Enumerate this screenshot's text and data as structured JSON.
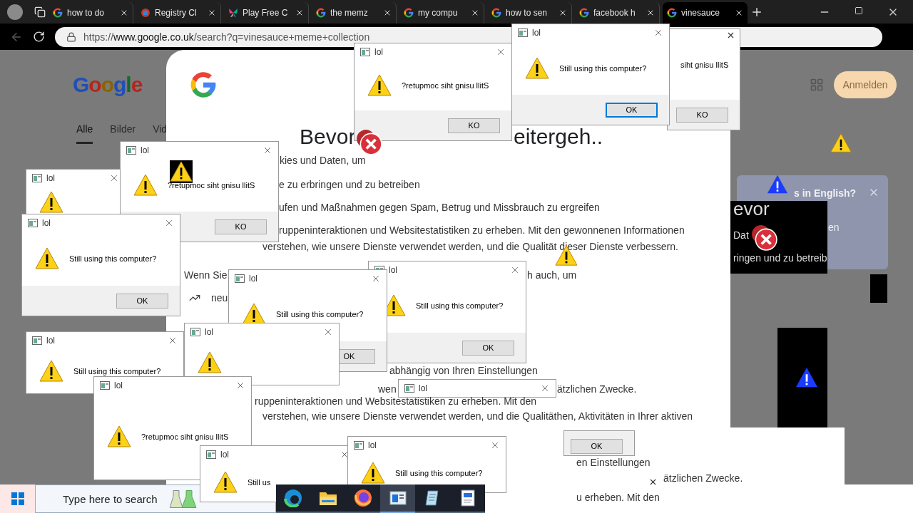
{
  "tabs": [
    {
      "title": "how to do",
      "kind": "google",
      "selected": false
    },
    {
      "title": "Registry Cl",
      "kind": "registry",
      "selected": false
    },
    {
      "title": "Play Free C",
      "kind": "games",
      "selected": false
    },
    {
      "title": "the memz",
      "kind": "google",
      "selected": false
    },
    {
      "title": "my compu",
      "kind": "google",
      "selected": false
    },
    {
      "title": "how to sen",
      "kind": "google",
      "selected": false
    },
    {
      "title": "facebook h",
      "kind": "google",
      "selected": false
    },
    {
      "title": "vinesauce",
      "kind": "google",
      "selected": true
    }
  ],
  "address": {
    "scheme": "https://",
    "host": "www.google.co.uk",
    "path": "/search?q=vinesauce+meme+collection"
  },
  "google_page": {
    "logo": "Google",
    "tabs": [
      {
        "label": "Alle",
        "selected": true
      },
      {
        "label": "Bilder",
        "selected": false
      },
      {
        "label": "Vid",
        "selected": false
      }
    ],
    "sign_in": "Anmelden"
  },
  "consent": {
    "heading_start": "Bevor",
    "heading_end": "eitergeh..",
    "lines": [
      {
        "text": "kies und Daten, um"
      },
      {
        "text": "e zu erbringen und zu betreiben"
      },
      {
        "text": "ufen und Maßnahmen gegen Spam, Betrug und Missbrauch zu ergreifen"
      },
      {
        "text": "ruppeninteraktionen und Websitestatistiken zu erheben. Mit den gewonnenen Informationen"
      },
      {
        "text": "verstehen, wie unsere Dienste verwendet werden, und die Qualität dieser Dienste verbessern."
      },
      {
        "text": "Wenn Sie"
      },
      {
        "text": "h auch, um"
      },
      {
        "text": "neu"
      },
      {
        "text": "abhängig von Ihren Einstellungen"
      },
      {
        "text": "wen"
      },
      {
        "text": "ätzlichen Zwecke."
      }
    ]
  },
  "ghost_lines": [
    {
      "text": "ruppeninteraktionen und Websitestatistiken zu erheben. Mit den"
    },
    {
      "text": "verstehen, wie unsere Dienste verwendet werden, und die Qualitäthen, Aktivitäten in Ihrer aktiven"
    },
    {
      "text": "en Einstellungen"
    },
    {
      "text": "ätzlichen Zwecke."
    },
    {
      "text": "u erheben. Mit den"
    }
  ],
  "side_panel": {
    "card_text": "s in English?",
    "card_line": "en",
    "dark_heading": "evor",
    "dark_word": "Dat",
    "dark_line": "ringen und zu betreib"
  },
  "dialogs": [
    {
      "title": "lol",
      "icon": true
    },
    {
      "title": "lol",
      "message": "?retupmoc siht gnisu llitS",
      "button": "KO",
      "icon": true,
      "focused": false
    },
    {
      "title": "lol",
      "message": "Still using this computer?",
      "button": "OK",
      "icon": true,
      "focused": false
    },
    {
      "title": "lol",
      "message": "?retupmoc siht gnisu llitS",
      "button": "KO",
      "icon": true,
      "focused": false
    },
    {
      "message": "siht gnisu llitS",
      "button": "KO",
      "icon": false,
      "focused": false
    },
    {
      "title": "lol",
      "message": "Still using this computer?",
      "button": "OK",
      "icon": true,
      "focused": true
    },
    {
      "title": "lol",
      "message": "Still using this computer?",
      "button": "OK",
      "icon": true,
      "focused": false
    },
    {
      "title": "lol",
      "message": "Still using this computer?",
      "button": "OK",
      "icon": true,
      "focused": false
    },
    {
      "title": "lol",
      "message": "Still using this computer?",
      "icon": true
    },
    {
      "title": "lol",
      "icon": true
    },
    {
      "title": "lol",
      "message": "?retupmoc siht gnisu llitS",
      "icon": true
    },
    {
      "title": "lol"
    },
    {
      "button": "OK",
      "focused": false
    },
    {
      "title": "lol",
      "message": "Still us",
      "icon": true
    },
    {
      "title": "lol",
      "message": "Still using this computer?",
      "icon": true
    }
  ],
  "taskbar": {
    "search_placeholder": "Type here to search",
    "apps": [
      {
        "kind": "edge",
        "selected": false
      },
      {
        "kind": "folder",
        "selected": false
      },
      {
        "kind": "firefox",
        "selected": false
      },
      {
        "kind": "window",
        "selected": true
      },
      {
        "kind": "notepad",
        "selected": false
      },
      {
        "kind": "document",
        "selected": false
      }
    ]
  }
}
